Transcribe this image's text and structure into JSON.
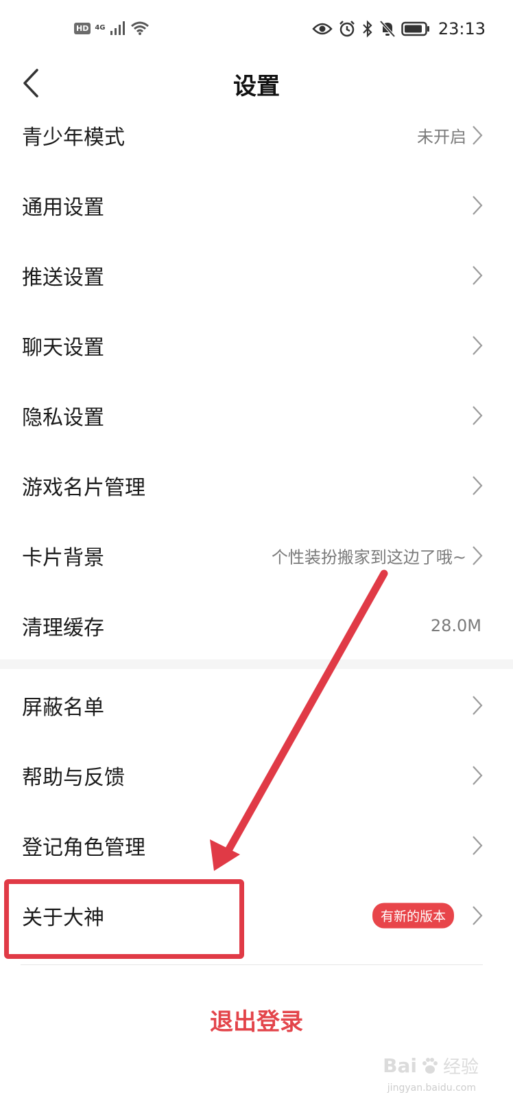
{
  "status_bar": {
    "hd": "HD",
    "network": "4G",
    "time": "23:13"
  },
  "header": {
    "title": "设置"
  },
  "settings_group_1": [
    {
      "label": "青少年模式",
      "value": "未开启"
    },
    {
      "label": "通用设置",
      "value": ""
    },
    {
      "label": "推送设置",
      "value": ""
    },
    {
      "label": "聊天设置",
      "value": ""
    },
    {
      "label": "隐私设置",
      "value": ""
    },
    {
      "label": "游戏名片管理",
      "value": ""
    },
    {
      "label": "卡片背景",
      "value": "个性装扮搬家到这边了哦~"
    },
    {
      "label": "清理缓存",
      "value": "28.0M"
    }
  ],
  "settings_group_2": [
    {
      "label": "屏蔽名单"
    },
    {
      "label": "帮助与反馈"
    },
    {
      "label": "登记角色管理"
    },
    {
      "label": "关于大神",
      "badge": "有新的版本"
    }
  ],
  "logout_label": "退出登录",
  "watermark": {
    "brand": "Bai",
    "suffix": "经验",
    "url": "jingyan.baidu.com"
  },
  "colors": {
    "accent_red": "#e3444a",
    "annotation_red": "#e03a46",
    "text_primary": "#1a1a1a",
    "text_secondary": "#7a7a7a"
  },
  "icons": {
    "back": "chevron-left-icon",
    "row_arrow": "chevron-right-icon",
    "status": [
      "eye-icon",
      "alarm-icon",
      "bluetooth-icon",
      "mute-icon",
      "battery-icon",
      "wifi-icon",
      "signal-icon"
    ]
  }
}
